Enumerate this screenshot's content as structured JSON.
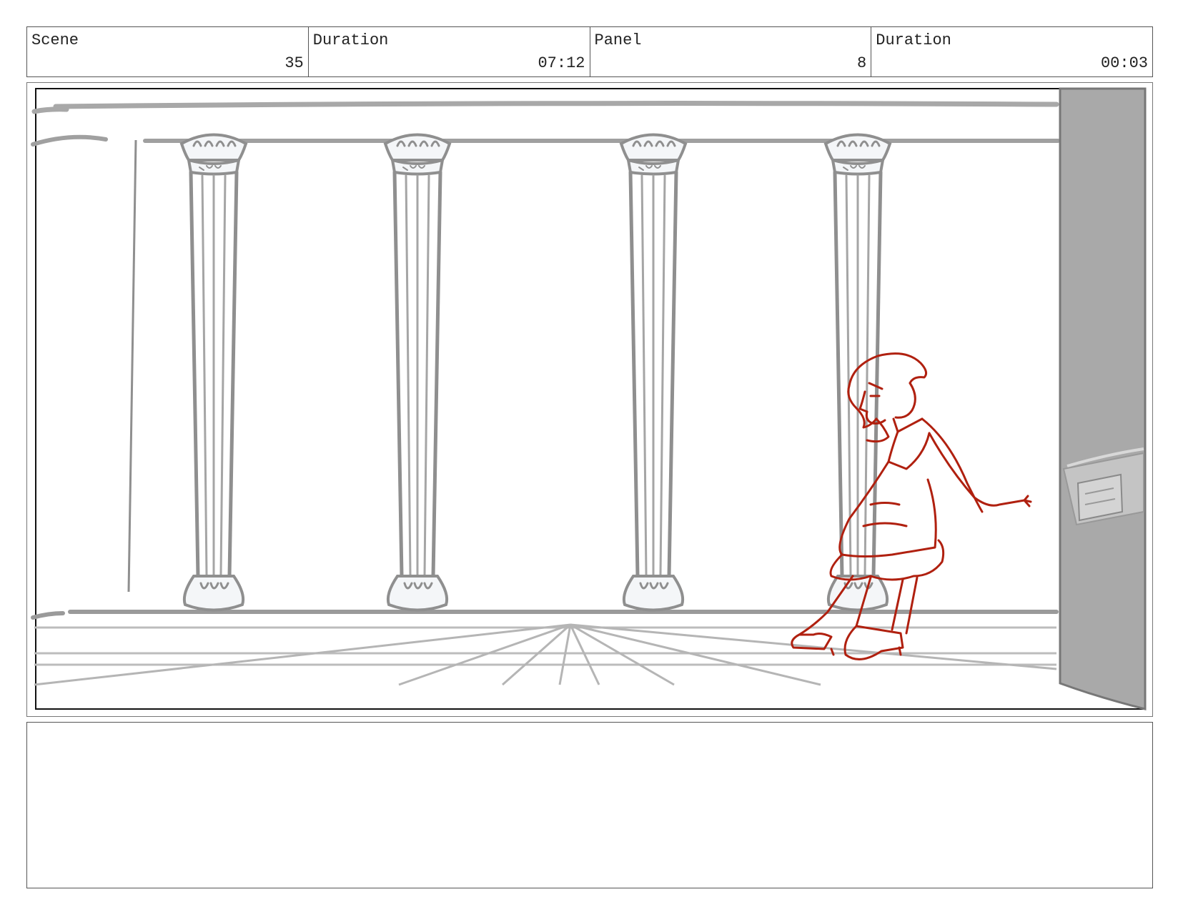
{
  "header": {
    "scene": {
      "label": "Scene",
      "value": "35"
    },
    "scene_duration": {
      "label": "Duration",
      "value": "07:12"
    },
    "panel": {
      "label": "Panel",
      "value": "8"
    },
    "panel_duration": {
      "label": "Duration",
      "value": "00:03"
    }
  },
  "colors": {
    "sketch_gray": "#9a9a9a",
    "character_red": "#b0200f",
    "wall_fill": "#a9a9a9"
  },
  "notes": {
    "text": ""
  }
}
